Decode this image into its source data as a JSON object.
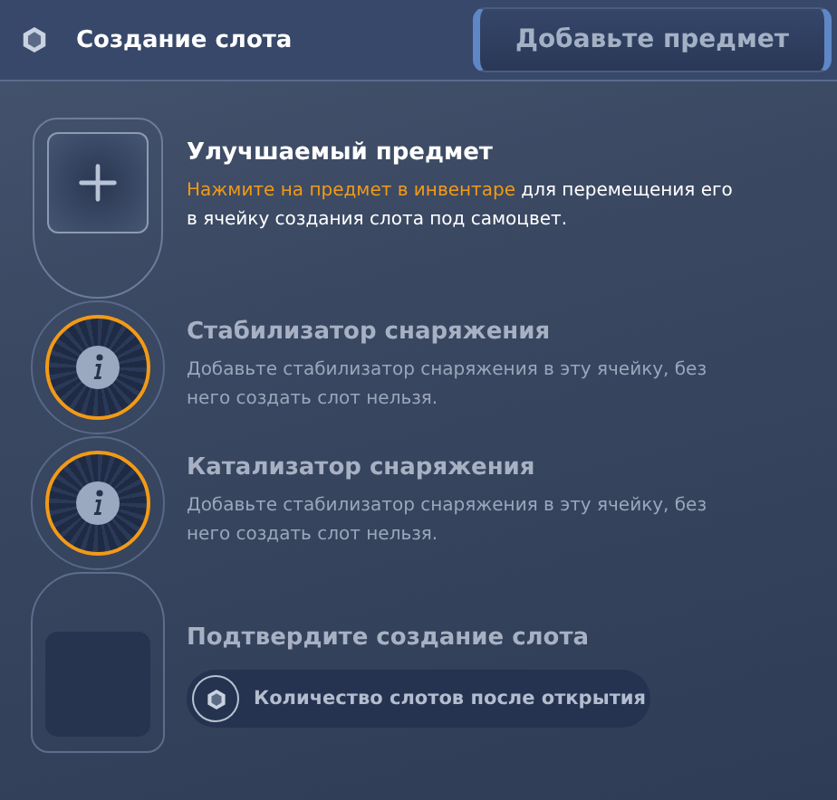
{
  "header": {
    "title": "Создание слота",
    "action_button": "Добавьте предмет"
  },
  "steps": [
    {
      "kind": "plus",
      "active": true,
      "title": "Улучшаемый предмет",
      "description": "**Нажмите на предмет в инвентаре** для перемещения его в ячейку создания слота под самоцвет."
    },
    {
      "kind": "info",
      "active": false,
      "title": "Стабилизатор снаряжения",
      "description": "Добавьте стабилизатор снаряжения в эту ячейку, без него создать слот нельзя."
    },
    {
      "kind": "info",
      "active": false,
      "title": "Катализатор снаряжения",
      "description": "Добавьте стабилизатор снаряжения в эту ячейку, без него создать слот нельзя."
    },
    {
      "kind": "confirm",
      "active": false,
      "title": "Подтвердите создание слота",
      "pill": "Количество слотов после открытия"
    }
  ]
}
